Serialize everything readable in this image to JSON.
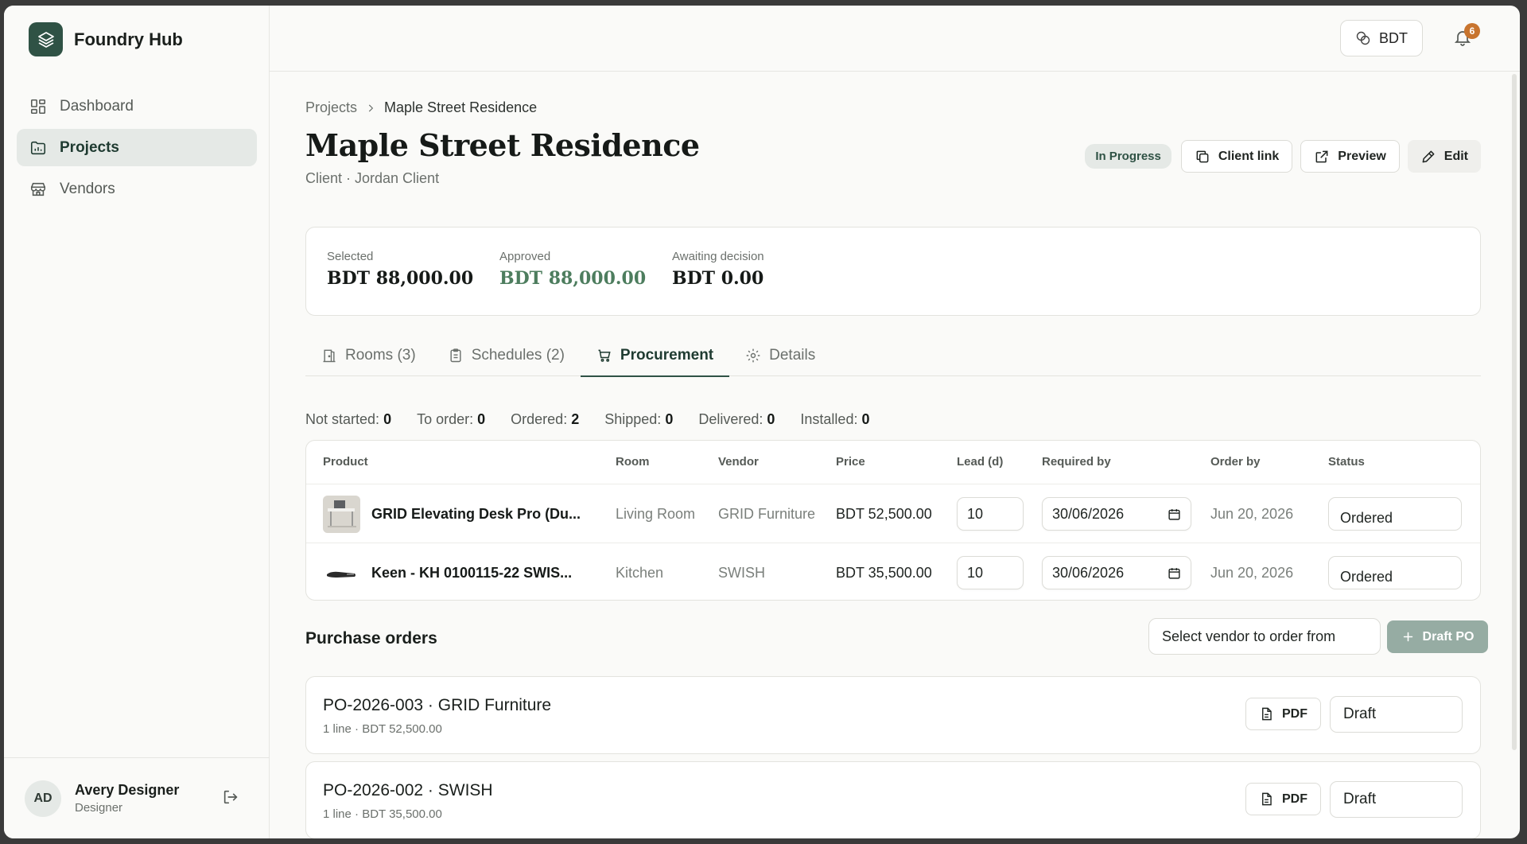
{
  "app": {
    "name": "Foundry Hub"
  },
  "sidebar": {
    "items": [
      {
        "label": "Dashboard",
        "icon": "dashboard-icon"
      },
      {
        "label": "Projects",
        "icon": "folder-chart-icon"
      },
      {
        "label": "Vendors",
        "icon": "store-icon"
      }
    ],
    "user": {
      "initials": "AD",
      "name": "Avery Designer",
      "role": "Designer"
    }
  },
  "topbar": {
    "currency": "BDT",
    "notifications": "6"
  },
  "breadcrumb": {
    "parent": "Projects",
    "current": "Maple Street Residence"
  },
  "project": {
    "title": "Maple Street Residence",
    "client": "Client · Jordan Client",
    "status": "In Progress",
    "actions": {
      "client_link": "Client link",
      "preview": "Preview",
      "edit": "Edit"
    }
  },
  "summary": {
    "selected_label": "Selected",
    "selected_value": "BDT 88,000.00",
    "approved_label": "Approved",
    "approved_value": "BDT 88,000.00",
    "awaiting_label": "Awaiting decision",
    "awaiting_value": "BDT 0.00"
  },
  "tabs": [
    {
      "label": "Rooms (3)"
    },
    {
      "label": "Schedules (2)"
    },
    {
      "label": "Procurement"
    },
    {
      "label": "Details"
    }
  ],
  "stats": [
    {
      "label": "Not started:",
      "value": "0"
    },
    {
      "label": "To order:",
      "value": "0"
    },
    {
      "label": "Ordered:",
      "value": "2"
    },
    {
      "label": "Shipped:",
      "value": "0"
    },
    {
      "label": "Delivered:",
      "value": "0"
    },
    {
      "label": "Installed:",
      "value": "0"
    }
  ],
  "table": {
    "headers": [
      "Product",
      "Room",
      "Vendor",
      "Price",
      "Lead (d)",
      "Required by",
      "Order by",
      "Status"
    ],
    "rows": [
      {
        "product": "GRID Elevating Desk Pro (Du...",
        "room": "Living Room",
        "vendor": "GRID Furniture",
        "price": "BDT 52,500.00",
        "lead": "10",
        "required_by": "30/06/2026",
        "order_by": "Jun 20, 2026",
        "status": "Ordered"
      },
      {
        "product": "Keen - KH 0100115-22 SWIS...",
        "room": "Kitchen",
        "vendor": "SWISH",
        "price": "BDT 35,500.00",
        "lead": "10",
        "required_by": "30/06/2026",
        "order_by": "Jun 20, 2026",
        "status": "Ordered"
      }
    ]
  },
  "purchase_orders": {
    "title": "Purchase orders",
    "vendor_select": "Select vendor to order from",
    "draft_label": "Draft PO",
    "items": [
      {
        "name": "PO-2026-003 · GRID Furniture",
        "meta": "1 line · BDT 52,500.00",
        "pdf": "PDF",
        "status": "Draft"
      },
      {
        "name": "PO-2026-002 · SWISH",
        "meta": "1 line · BDT 35,500.00",
        "pdf": "PDF",
        "status": "Draft"
      }
    ]
  },
  "colors": {
    "accent": "#2f5245",
    "approved": "#4d7d5e",
    "badge": "#c8742e"
  }
}
